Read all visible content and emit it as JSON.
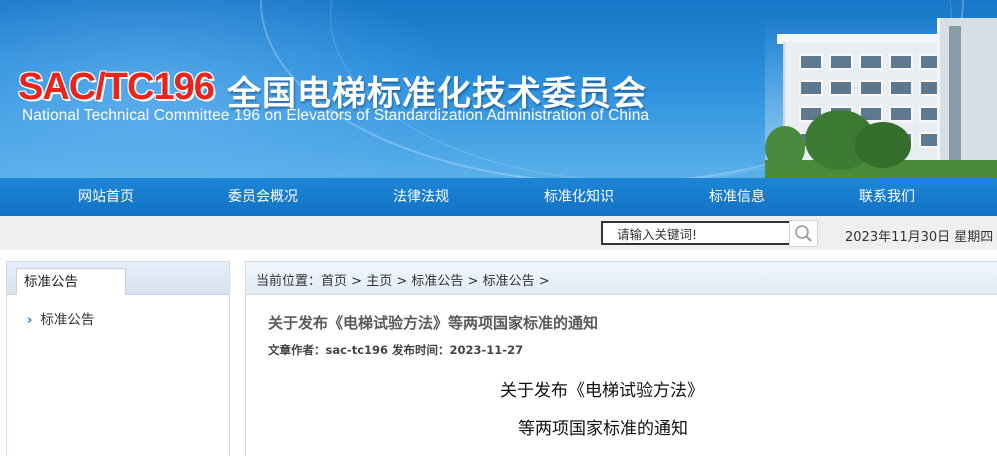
{
  "header": {
    "code": "SAC/TC196",
    "name_cn": "全国电梯标准化技术委员会",
    "name_en": "National Technical Committee 196 on Elevators of Standardization Administration of China"
  },
  "nav": {
    "items": [
      "网站首页",
      "委员会概况",
      "法律法规",
      "标准化知识",
      "标准信息",
      "联系我们"
    ]
  },
  "search": {
    "placeholder": "请输入关键词!"
  },
  "date": "2023年11月30日 星期四",
  "sidebar": {
    "title": "标准公告",
    "items": [
      {
        "label": "标准公告"
      }
    ]
  },
  "breadcrumb": {
    "prefix": "当前位置：",
    "items": [
      "首页",
      "主页",
      "标准公告",
      "标准公告"
    ],
    "separator": " > "
  },
  "article": {
    "title": "关于发布《电梯试验方法》等两项国家标准的通知",
    "meta": "文章作者：sac-tc196 发布时间：2023-11-27",
    "body_line1": "关于发布《电梯试验方法》",
    "body_line2": "等两项国家标准的通知"
  },
  "colors": {
    "nav_blue": "#1677c7",
    "code_red": "#e8241c"
  }
}
